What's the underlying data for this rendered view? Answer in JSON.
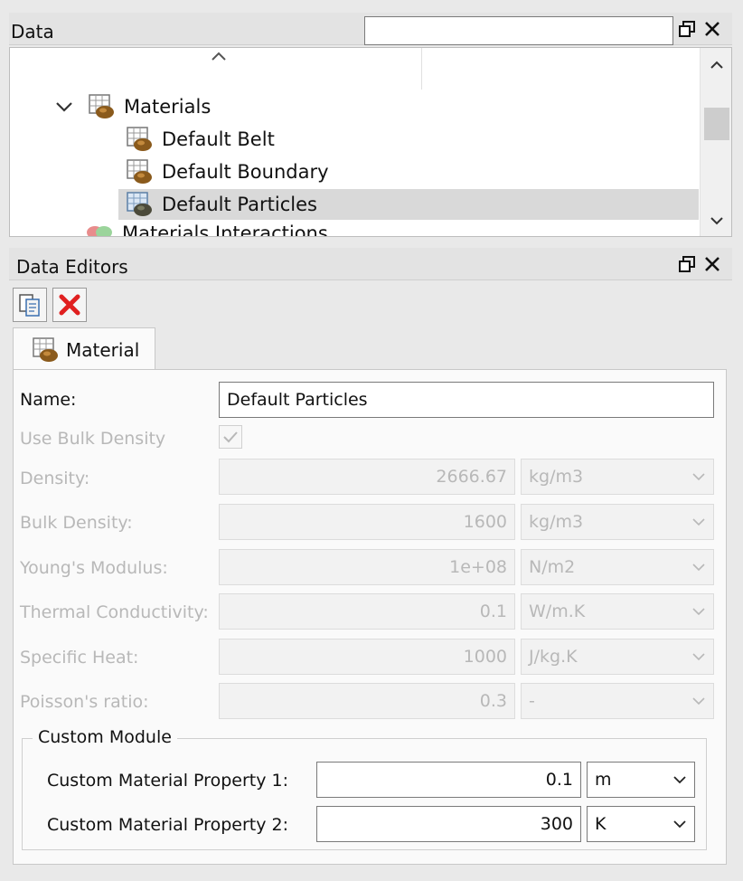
{
  "data_panel": {
    "title": "Data",
    "search": {
      "value": "",
      "placeholder": ""
    },
    "tree": {
      "materials": "Materials",
      "items": [
        "Default Belt",
        "Default Boundary",
        "Default Particles"
      ],
      "partial_next": "Materials Interactions"
    }
  },
  "editors_panel": {
    "title": "Data Editors",
    "tab_label": "Material",
    "name_label": "Name:",
    "name_value": "Default Particles",
    "use_bulk_density_label": "Use Bulk Density",
    "use_bulk_density_checked": true,
    "properties": [
      {
        "label": "Density:",
        "value": "2666.67",
        "unit": "kg/m3"
      },
      {
        "label": "Bulk Density:",
        "value": "1600",
        "unit": "kg/m3"
      },
      {
        "label": "Young's Modulus:",
        "value": "1e+08",
        "unit": "N/m2"
      },
      {
        "label": "Thermal Conductivity:",
        "value": "0.1",
        "unit": "W/m.K"
      },
      {
        "label": "Specific Heat:",
        "value": "1000",
        "unit": "J/kg.K"
      },
      {
        "label": "Poisson's ratio:",
        "value": "0.3",
        "unit": "-"
      }
    ],
    "custom_module": {
      "title": "Custom Module",
      "properties": [
        {
          "label": "Custom Material Property 1:",
          "value": "0.1",
          "unit": "m"
        },
        {
          "label": "Custom Material Property 2:",
          "value": "300",
          "unit": "K"
        }
      ]
    }
  },
  "colors": {
    "selection": "#d9d9d9",
    "delete_red": "#e02020",
    "disabled_text": "#b8b8b8"
  }
}
